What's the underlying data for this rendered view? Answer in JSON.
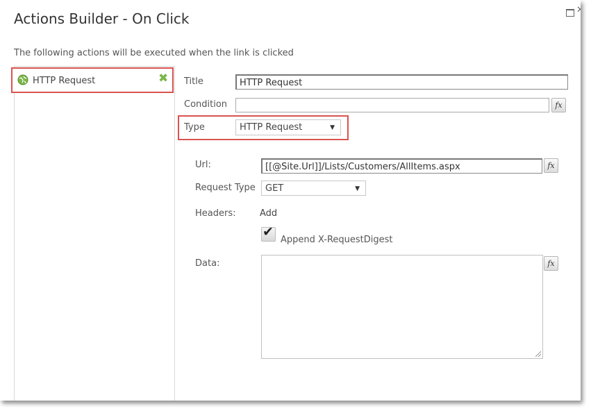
{
  "dialog": {
    "title": "Actions Builder - On Click",
    "description": "The following actions will be executed when the link is clicked"
  },
  "actions": [
    {
      "label": "HTTP Request",
      "icon": "globe-icon",
      "remove_icon": "remove-x-icon"
    }
  ],
  "form": {
    "title_label": "Title",
    "title_value": "HTTP Request",
    "condition_label": "Condition",
    "condition_value": "",
    "type_label": "Type",
    "type_value": "HTTP Request",
    "url_label": "Url:",
    "url_value": "[[@Site.Url]]/Lists/Customers/AllItems.aspx",
    "request_type_label": "Request Type",
    "request_type_value": "GET",
    "headers_label": "Headers:",
    "headers_add": "Add",
    "append_digest_label": "Append X-RequestDigest",
    "append_digest_checked": true,
    "data_label": "Data:",
    "data_value": "",
    "fx_label": "fx"
  },
  "colors": {
    "highlight": "#d9534f",
    "remove_icon": "#7ab648",
    "globe": "#7ab648"
  }
}
